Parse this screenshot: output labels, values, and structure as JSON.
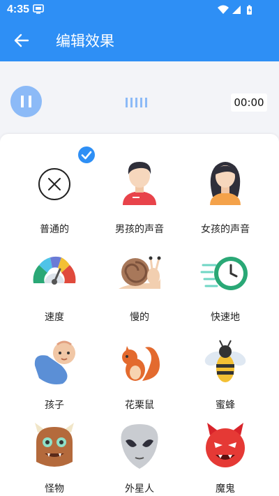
{
  "status_bar": {
    "time": "4:35"
  },
  "app_bar": {
    "title": "编辑效果"
  },
  "player": {
    "time": "00:00"
  },
  "effects": [
    {
      "label": "普通的",
      "icon": "normal-cross-icon",
      "selected": true
    },
    {
      "label": "男孩的声音",
      "icon": "boy-avatar-icon",
      "selected": false
    },
    {
      "label": "女孩的声音",
      "icon": "girl-avatar-icon",
      "selected": false
    },
    {
      "label": "速度",
      "icon": "speedometer-icon",
      "selected": false
    },
    {
      "label": "慢的",
      "icon": "snail-icon",
      "selected": false
    },
    {
      "label": "快速地",
      "icon": "fast-clock-icon",
      "selected": false
    },
    {
      "label": "孩子",
      "icon": "baby-icon",
      "selected": false
    },
    {
      "label": "花栗鼠",
      "icon": "squirrel-icon",
      "selected": false
    },
    {
      "label": "蜜蜂",
      "icon": "bee-icon",
      "selected": false
    },
    {
      "label": "怪物",
      "icon": "monster-icon",
      "selected": false
    },
    {
      "label": "外星人",
      "icon": "alien-icon",
      "selected": false
    },
    {
      "label": "魔鬼",
      "icon": "devil-icon",
      "selected": false
    }
  ],
  "colors": {
    "primary": "#2e8ff5",
    "accent_light": "#8cbaf7"
  }
}
